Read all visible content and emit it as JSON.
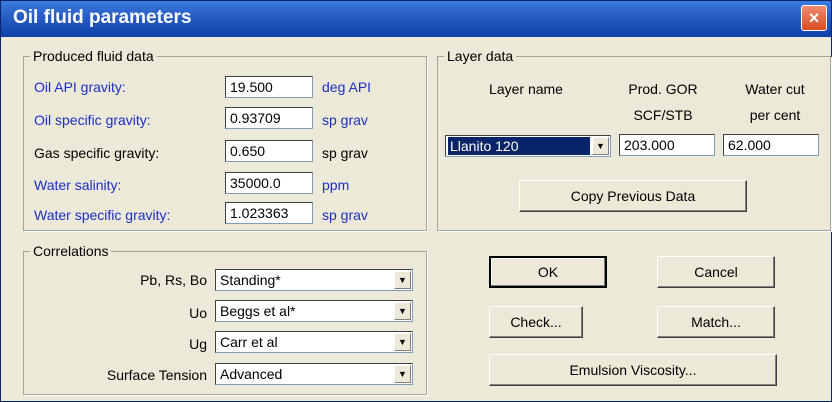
{
  "window": {
    "title": "Oil fluid parameters",
    "close_icon": "×"
  },
  "produced": {
    "legend": "Produced fluid data",
    "rows": [
      {
        "label": "Oil API gravity:",
        "value": "19.500",
        "unit": "deg API"
      },
      {
        "label": "Oil specific gravity:",
        "value": "0.93709",
        "unit": "sp grav"
      },
      {
        "label": "Gas specific gravity:",
        "value": "0.650",
        "unit": "sp grav"
      },
      {
        "label": "Water salinity:",
        "value": "35000.0",
        "unit": "ppm"
      },
      {
        "label": "Water specific gravity:",
        "value": "1.023363",
        "unit": "sp grav"
      }
    ]
  },
  "layer": {
    "legend": "Layer data",
    "col_name": "Layer name",
    "col_gor_1": "Prod. GOR",
    "col_gor_2": "SCF/STB",
    "col_wc_1": "Water cut",
    "col_wc_2": "per cent",
    "layer_name": "Llanito 120",
    "gor": "203.000",
    "water_cut": "62.000",
    "copy_button": "Copy Previous Data"
  },
  "correlations": {
    "legend": "Correlations",
    "rows": [
      {
        "label": "Pb, Rs, Bo",
        "value": "Standing*"
      },
      {
        "label": "Uo",
        "value": "Beggs et al*"
      },
      {
        "label": "Ug",
        "value": "Carr et al"
      },
      {
        "label": "Surface Tension",
        "value": "Advanced"
      }
    ]
  },
  "buttons": {
    "ok": "OK",
    "cancel": "Cancel",
    "check": "Check...",
    "match": "Match...",
    "emulsion": "Emulsion Viscosity..."
  },
  "colors": {
    "titlebar": "#0f3fa8",
    "label_blue": "#1a2fc8",
    "dialog_bg": "#ece9d8",
    "selection": "#0a246a"
  }
}
